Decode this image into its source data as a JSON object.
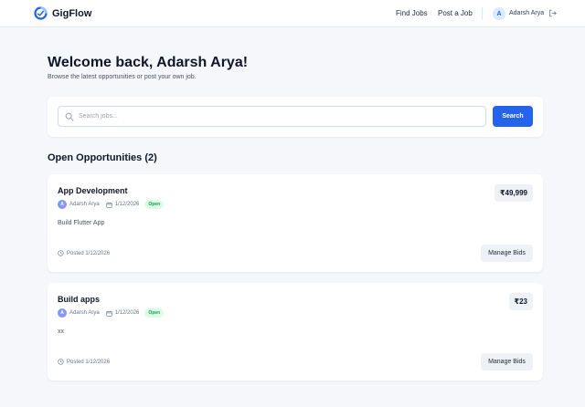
{
  "nav": {
    "brand": "GigFlow",
    "links": [
      "Find Jobs",
      "Post a Job"
    ],
    "user_initial": "A",
    "user_name": "Adarsh Arya"
  },
  "header": {
    "title": "Welcome back, Adarsh Arya!",
    "subtitle": "Browse the latest opportunities or post your own job."
  },
  "search": {
    "placeholder": "Search jobs...",
    "value": "",
    "button_label": "Search"
  },
  "section": {
    "title": "Open Opportunities (2)"
  },
  "jobs": [
    {
      "title": "App Development",
      "owner_initial": "A",
      "owner": "Adarsh Arya",
      "date": "1/12/2026",
      "status": "Open",
      "description": "Build Flutter App",
      "price": "₹49,999",
      "posted": "Posted 1/12/2026",
      "action_label": "Manage Bids"
    },
    {
      "title": "Build apps",
      "owner_initial": "A",
      "owner": "Adarsh Arya",
      "date": "1/12/2026",
      "status": "Open",
      "description": "xx",
      "price": "₹23",
      "posted": "Posted 1/12/2026",
      "action_label": "Manage Bids"
    }
  ],
  "colors": {
    "accent": "#2563eb",
    "open_badge_text": "#16a34a",
    "open_badge_bg": "#dcfce7",
    "page_bg": "#f5f7fb"
  }
}
